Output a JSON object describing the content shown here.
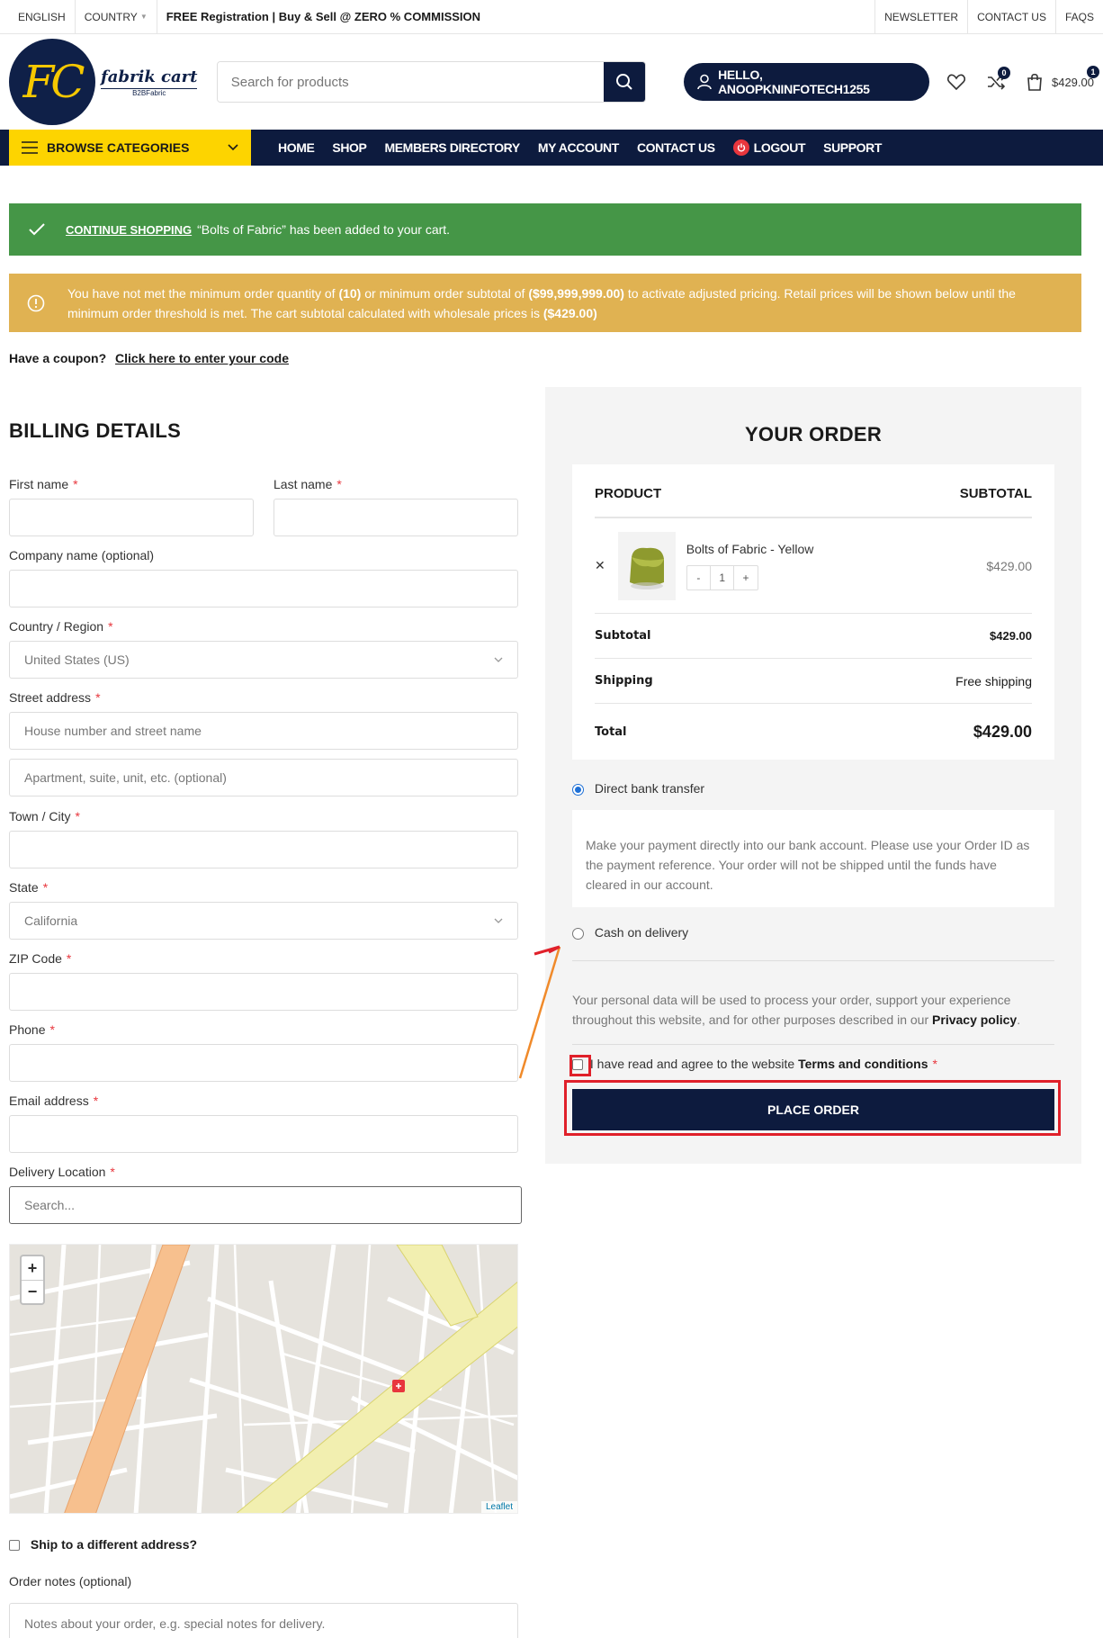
{
  "topbar": {
    "language": "ENGLISH",
    "country": "COUNTRY",
    "promo": "FREE Registration | Buy & Sell @ ZERO % COMMISSION",
    "links": [
      "NEWSLETTER",
      "CONTACT US",
      "FAQS"
    ]
  },
  "header": {
    "logo_initials": "FC",
    "logo_name": "fabrik cart",
    "logo_tagline": "B2BFabric",
    "search_placeholder": "Search for products",
    "greeting": "HELLO, ANOOPKNINFOTECH1255",
    "compare_count": "0",
    "cart_count": "1",
    "cart_total": "$429.00"
  },
  "nav": {
    "browse": "BROWSE CATEGORIES",
    "items": [
      "HOME",
      "SHOP",
      "MEMBERS DIRECTORY",
      "MY ACCOUNT",
      "CONTACT US",
      "LOGOUT",
      "SUPPORT"
    ]
  },
  "notices": {
    "success_link": "CONTINUE SHOPPING",
    "success_text": "“Bolts of Fabric” has been added to your cart.",
    "warning_text_1": "You have not met the minimum order quantity of",
    "warning_qty": "(10)",
    "warning_text_2": "or minimum order subtotal of",
    "warning_subtotal": "($99,999,999.00)",
    "warning_text_3": "to activate adjusted pricing. Retail prices will be shown below until the minimum order threshold is met. The cart subtotal calculated with wholesale prices is",
    "warning_wholesale": "($429.00)"
  },
  "coupon": {
    "question": "Have a coupon?",
    "link": "Click here to enter your code"
  },
  "billing": {
    "title": "BILLING DETAILS",
    "first_name": "First name",
    "last_name": "Last name",
    "company": "Company name (optional)",
    "country_label": "Country / Region",
    "country_value": "United States (US)",
    "street_label": "Street address",
    "street_placeholder": "House number and street name",
    "street2_placeholder": "Apartment, suite, unit, etc. (optional)",
    "city": "Town / City",
    "state_label": "State",
    "state_value": "California",
    "zip": "ZIP Code",
    "phone": "Phone",
    "email": "Email address",
    "delivery_label": "Delivery Location",
    "delivery_placeholder": "Search...",
    "map_attribution": "Leaflet",
    "ship_different": "Ship to a different address?",
    "notes_label": "Order notes (optional)",
    "notes_placeholder": "Notes about your order, e.g. special notes for delivery."
  },
  "order": {
    "title": "YOUR ORDER",
    "col_product": "PRODUCT",
    "col_subtotal": "SUBTOTAL",
    "item_name": "Bolts of Fabric - Yellow",
    "item_qty": "1",
    "item_price": "$429.00",
    "subtotal_label": "Subtotal",
    "subtotal_value": "$429.00",
    "shipping_label": "Shipping",
    "shipping_value": "Free shipping",
    "total_label": "Total",
    "total_value": "$429.00"
  },
  "payment": {
    "bank": "Direct bank transfer",
    "bank_desc": "Make your payment directly into our bank account. Please use your Order ID as the payment reference. Your order will not be shipped until the funds have cleared in our account.",
    "cod": "Cash on delivery",
    "privacy_text": "Your personal data will be used to process your order, support your experience throughout this website, and for other purposes described in our",
    "privacy_link": "Privacy policy",
    "terms_text": "I have read and agree to the website",
    "terms_link": "Terms and conditions",
    "place_order": "PLACE ORDER"
  },
  "colors": {
    "navy": "#0d1b3e",
    "yellow": "#fdd400",
    "success": "#459647",
    "warning": "#e0b252",
    "annotation_red": "#e0202a",
    "annotation_arrow": "#f08a2a"
  }
}
